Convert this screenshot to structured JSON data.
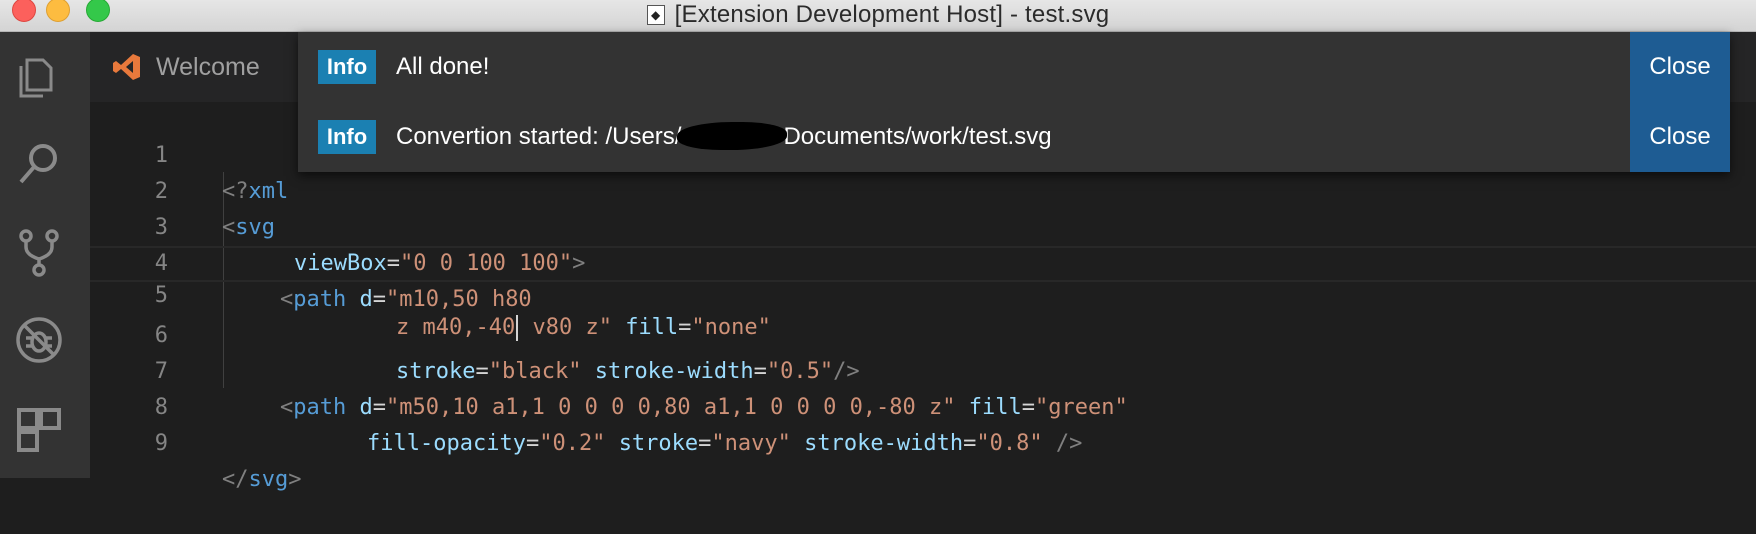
{
  "window": {
    "title": "[Extension Development Host] - test.svg",
    "icon": "inkscape-file-icon"
  },
  "activity_bar": {
    "icons": [
      "files-icon",
      "search-icon",
      "source-control-icon",
      "debug-icon",
      "extensions-icon"
    ]
  },
  "tabs": [
    {
      "label": "Welcome",
      "icon": "vscode-logo-icon"
    }
  ],
  "notifications": [
    {
      "badge": "Info",
      "message": "All done!",
      "close_label": "Close"
    },
    {
      "badge": "Info",
      "message_prefix": "Convertion started: /Users/",
      "message_suffix": "Documents/work/test.svg",
      "close_label": "Close"
    }
  ],
  "editor": {
    "line_numbers": [
      "1",
      "2",
      "3",
      "4",
      "5",
      "6",
      "7",
      "8",
      "9"
    ],
    "lines": {
      "l1": {
        "lt": "<?",
        "tag": "xml"
      },
      "l2": {
        "lt": "<",
        "tag": "svg"
      },
      "l3": {
        "attr": "viewBox",
        "eq": "=",
        "val": "\"0 0 100 100\"",
        "gt": ">"
      },
      "l4": {
        "lt": "<",
        "tag": "path",
        "attr": "d",
        "eq": "=",
        "val": "\"m10,50 h80"
      },
      "l5": {
        "val1": "z m40,-40",
        "val2": " v80 z\"",
        "attr": "fill",
        "eq": "=",
        "val3": "\"none\""
      },
      "l6": {
        "attr1": "stroke",
        "eq1": "=",
        "val1": "\"black\"",
        "attr2": "stroke-width",
        "eq2": "=",
        "val2": "\"0.5\"",
        "end": "/>"
      },
      "l7": {
        "lt": "<",
        "tag": "path",
        "attr1": "d",
        "eq1": "=",
        "val1": "\"m50,10 a1,1 0 0 0 0,80 a1,1 0 0 0 0,-80 z\"",
        "attr2": "fill",
        "eq2": "=",
        "val2": "\"green\""
      },
      "l8": {
        "attr1": "fill-opacity",
        "eq1": "=",
        "val1": "\"0.2\"",
        "attr2": "stroke",
        "eq2": "=",
        "val2": "\"navy\"",
        "attr3": "stroke-width",
        "eq3": "=",
        "val3": "\"0.8\"",
        "end": "/>"
      },
      "l9": {
        "lt": "</",
        "tag": "svg",
        "gt": ">"
      }
    }
  },
  "colors": {
    "activity_bar": "#333333",
    "editor_bg": "#1e1e1e",
    "info_badge": "#1b80b2",
    "close_button": "#1e5c93",
    "tag": "#569cd6",
    "attribute": "#9cdcfe",
    "string": "#ce9178"
  }
}
